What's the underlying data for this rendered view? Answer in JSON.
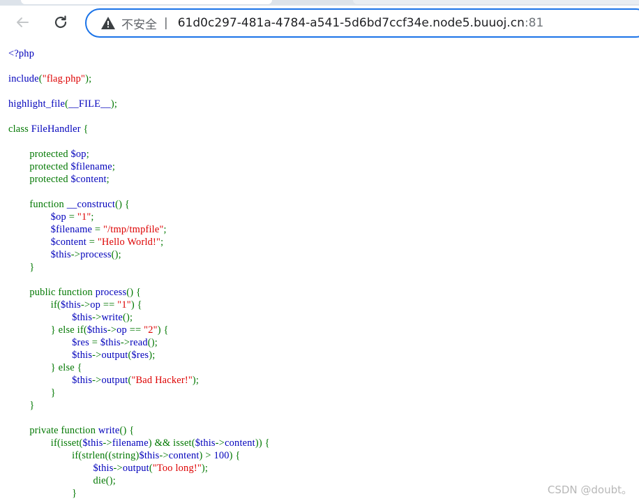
{
  "browser": {
    "security_label": "不安全",
    "separator": "|",
    "url_host": "61d0c297-481a-4784-a541-5d6bd7ccf34e.node5.buuoj.cn",
    "url_port": ":81"
  },
  "colors": {
    "keyword": "#0000BB",
    "string": "#DD0000",
    "punct": "#007700",
    "accent": "#1A73E8"
  },
  "icons": {
    "back": "back-arrow-icon",
    "reload": "reload-icon",
    "security": "warning-triangle-icon"
  },
  "code": {
    "lines": [
      [
        [
          "k",
          "<?php"
        ]
      ],
      [],
      [
        [
          "k",
          "include"
        ],
        [
          "p",
          "("
        ],
        [
          "s",
          "\"flag.php\""
        ],
        [
          "p",
          ");"
        ]
      ],
      [],
      [
        [
          "k",
          "highlight_file"
        ],
        [
          "p",
          "("
        ],
        [
          "k",
          "__FILE__"
        ],
        [
          "p",
          ");"
        ]
      ],
      [],
      [
        [
          "p",
          "class "
        ],
        [
          "k",
          "FileHandler "
        ],
        [
          "p",
          "{"
        ]
      ],
      [],
      [
        [
          "p",
          "        protected "
        ],
        [
          "k",
          "$op"
        ],
        [
          "p",
          ";"
        ]
      ],
      [
        [
          "p",
          "        protected "
        ],
        [
          "k",
          "$filename"
        ],
        [
          "p",
          ";"
        ]
      ],
      [
        [
          "p",
          "        protected "
        ],
        [
          "k",
          "$content"
        ],
        [
          "p",
          ";"
        ]
      ],
      [],
      [
        [
          "p",
          "        function "
        ],
        [
          "k",
          "__construct"
        ],
        [
          "p",
          "() {"
        ]
      ],
      [
        [
          "k",
          "                $op "
        ],
        [
          "p",
          "= "
        ],
        [
          "s",
          "\"1\""
        ],
        [
          "p",
          ";"
        ]
      ],
      [
        [
          "k",
          "                $filename "
        ],
        [
          "p",
          "= "
        ],
        [
          "s",
          "\"/tmp/tmpfile\""
        ],
        [
          "p",
          ";"
        ]
      ],
      [
        [
          "k",
          "                $content "
        ],
        [
          "p",
          "= "
        ],
        [
          "s",
          "\"Hello World!\""
        ],
        [
          "p",
          ";"
        ]
      ],
      [
        [
          "k",
          "                $this"
        ],
        [
          "p",
          "->"
        ],
        [
          "k",
          "process"
        ],
        [
          "p",
          "();"
        ]
      ],
      [
        [
          "p",
          "        }"
        ]
      ],
      [],
      [
        [
          "p",
          "        public function "
        ],
        [
          "k",
          "process"
        ],
        [
          "p",
          "() {"
        ]
      ],
      [
        [
          "p",
          "                if("
        ],
        [
          "k",
          "$this"
        ],
        [
          "p",
          "->"
        ],
        [
          "k",
          "op "
        ],
        [
          "p",
          "== "
        ],
        [
          "s",
          "\"1\""
        ],
        [
          "p",
          ") {"
        ]
      ],
      [
        [
          "k",
          "                        $this"
        ],
        [
          "p",
          "->"
        ],
        [
          "k",
          "write"
        ],
        [
          "p",
          "();"
        ]
      ],
      [
        [
          "p",
          "                } else if("
        ],
        [
          "k",
          "$this"
        ],
        [
          "p",
          "->"
        ],
        [
          "k",
          "op "
        ],
        [
          "p",
          "== "
        ],
        [
          "s",
          "\"2\""
        ],
        [
          "p",
          ") {"
        ]
      ],
      [
        [
          "k",
          "                        $res "
        ],
        [
          "p",
          "= "
        ],
        [
          "k",
          "$this"
        ],
        [
          "p",
          "->"
        ],
        [
          "k",
          "read"
        ],
        [
          "p",
          "();"
        ]
      ],
      [
        [
          "k",
          "                        $this"
        ],
        [
          "p",
          "->"
        ],
        [
          "k",
          "output"
        ],
        [
          "p",
          "("
        ],
        [
          "k",
          "$res"
        ],
        [
          "p",
          ");"
        ]
      ],
      [
        [
          "p",
          "                } else {"
        ]
      ],
      [
        [
          "k",
          "                        $this"
        ],
        [
          "p",
          "->"
        ],
        [
          "k",
          "output"
        ],
        [
          "p",
          "("
        ],
        [
          "s",
          "\"Bad Hacker!\""
        ],
        [
          "p",
          ");"
        ]
      ],
      [
        [
          "p",
          "                }"
        ]
      ],
      [
        [
          "p",
          "        }"
        ]
      ],
      [],
      [
        [
          "p",
          "        private function "
        ],
        [
          "k",
          "write"
        ],
        [
          "p",
          "() {"
        ]
      ],
      [
        [
          "p",
          "                if(isset("
        ],
        [
          "k",
          "$this"
        ],
        [
          "p",
          "->"
        ],
        [
          "k",
          "filename"
        ],
        [
          "p",
          ") && isset("
        ],
        [
          "k",
          "$this"
        ],
        [
          "p",
          "->"
        ],
        [
          "k",
          "content"
        ],
        [
          "p",
          ")) {"
        ]
      ],
      [
        [
          "p",
          "                        if(strlen((string)"
        ],
        [
          "k",
          "$this"
        ],
        [
          "p",
          "->"
        ],
        [
          "k",
          "content"
        ],
        [
          "p",
          ") > "
        ],
        [
          "k",
          "100"
        ],
        [
          "p",
          ") {"
        ]
      ],
      [
        [
          "k",
          "                                $this"
        ],
        [
          "p",
          "->"
        ],
        [
          "k",
          "output"
        ],
        [
          "p",
          "("
        ],
        [
          "s",
          "\"Too long!\""
        ],
        [
          "p",
          ");"
        ]
      ],
      [
        [
          "p",
          "                                die();"
        ]
      ],
      [
        [
          "p",
          "                        }"
        ]
      ]
    ]
  },
  "watermark": "CSDN @doubt。"
}
